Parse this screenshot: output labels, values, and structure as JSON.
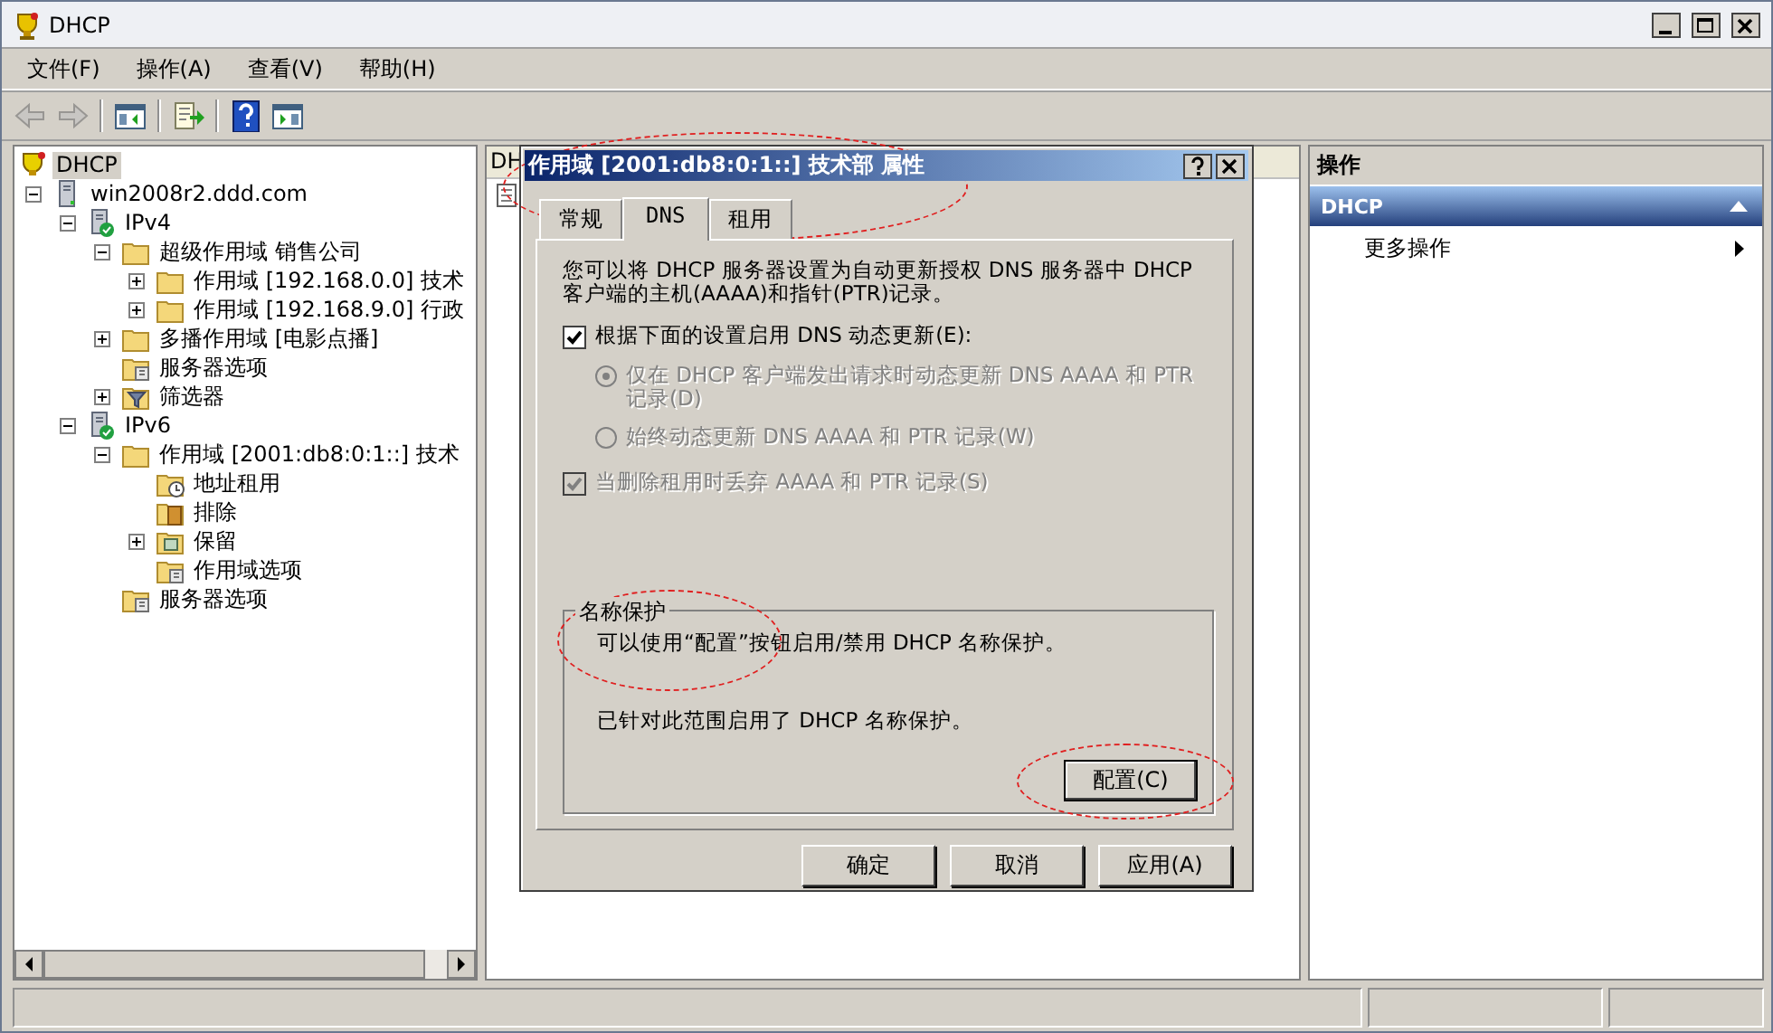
{
  "window": {
    "title": "DHCP"
  },
  "menu": [
    "文件(F)",
    "操作(A)",
    "查看(V)",
    "帮助(H)"
  ],
  "toolbar": [
    {
      "kind": "back",
      "disabled": true
    },
    {
      "kind": "forward",
      "disabled": true
    },
    {
      "kind": "tree-pane",
      "disabled": false
    },
    {
      "kind": "export",
      "disabled": false
    },
    {
      "kind": "help",
      "disabled": false
    },
    {
      "kind": "action-pane",
      "disabled": false
    }
  ],
  "tree": [
    {
      "label": "DHCP",
      "kind": "root",
      "selected": true,
      "children": [
        {
          "label": "win2008r2.ddd.com",
          "kind": "server",
          "selected": false,
          "expanded": true,
          "children": [
            {
              "label": "IPv4",
              "kind": "network",
              "selected": false,
              "expanded": true,
              "children": [
                {
                  "label": "超级作用域 销售公司",
                  "kind": "folder",
                  "selected": false,
                  "expanded": true,
                  "children": [
                    {
                      "label": "作用域 [192.168.0.0] 技术",
                      "kind": "folder",
                      "selected": false,
                      "expanded": false
                    },
                    {
                      "label": "作用域 [192.168.9.0] 行政",
                      "kind": "folder",
                      "selected": false,
                      "expanded": false
                    }
                  ]
                },
                {
                  "label": "多播作用域 [电影点播]",
                  "kind": "folder",
                  "selected": false,
                  "expanded": false
                },
                {
                  "label": "服务器选项",
                  "kind": "options",
                  "selected": false
                },
                {
                  "label": "筛选器",
                  "kind": "filter",
                  "selected": false,
                  "expanded": false
                }
              ]
            },
            {
              "label": "IPv6",
              "kind": "network",
              "selected": false,
              "expanded": true,
              "children": [
                {
                  "label": "作用域 [2001:db8:0:1::] 技术",
                  "kind": "folder",
                  "selected": false,
                  "expanded": true,
                  "children": [
                    {
                      "label": "地址租用",
                      "kind": "lease",
                      "selected": false
                    },
                    {
                      "label": "排除",
                      "kind": "exclusion",
                      "selected": false
                    },
                    {
                      "label": "保留",
                      "kind": "reservation",
                      "selected": false,
                      "expanded": false
                    },
                    {
                      "label": "作用域选项",
                      "kind": "options",
                      "selected": false
                    }
                  ]
                },
                {
                  "label": "服务器选项",
                  "kind": "options",
                  "selected": false
                }
              ]
            }
          ]
        }
      ]
    }
  ],
  "middle_pane": {
    "column_1": "DH"
  },
  "actions": {
    "title": "操作",
    "section": "DHCP",
    "items": [
      {
        "label": "更多操作"
      }
    ]
  },
  "dialog": {
    "title": "作用域 [2001:db8:0:1::] 技术部 属性",
    "title_circled": true,
    "tabs": [
      {
        "label": "常规",
        "selected": false
      },
      {
        "label": "DNS",
        "selected": true
      },
      {
        "label": "租用",
        "selected": false
      }
    ],
    "intro": "您可以将 DHCP 服务器设置为自动更新授权 DNS 服务器中 DHCP 客户端的主机(AAAA)和指针(PTR)记录。",
    "enable_update": {
      "label": "根据下面的设置启用 DNS 动态更新(E):",
      "checked": true,
      "disabled": false
    },
    "radios": [
      {
        "label": "仅在 DHCP 客户端发出请求时动态更新 DNS AAAA 和 PTR 记录(D)",
        "selected": true,
        "disabled": true
      },
      {
        "label": "始终动态更新 DNS AAAA 和 PTR 记录(W)",
        "selected": false,
        "disabled": true
      }
    ],
    "discard": {
      "label": "当删除租用时丢弃 AAAA 和 PTR 记录(S)",
      "checked": true,
      "disabled": true
    },
    "name_protection": {
      "label": "名称保护",
      "label_circled": true,
      "hint": "可以使用“配置”按钮启用/禁用 DHCP 名称保护。",
      "status": "已针对此范围启用了 DHCP 名称保护。",
      "button": "配置(C)",
      "button_circled": true
    },
    "buttons": [
      "确定",
      "取消",
      "应用(A)"
    ]
  }
}
